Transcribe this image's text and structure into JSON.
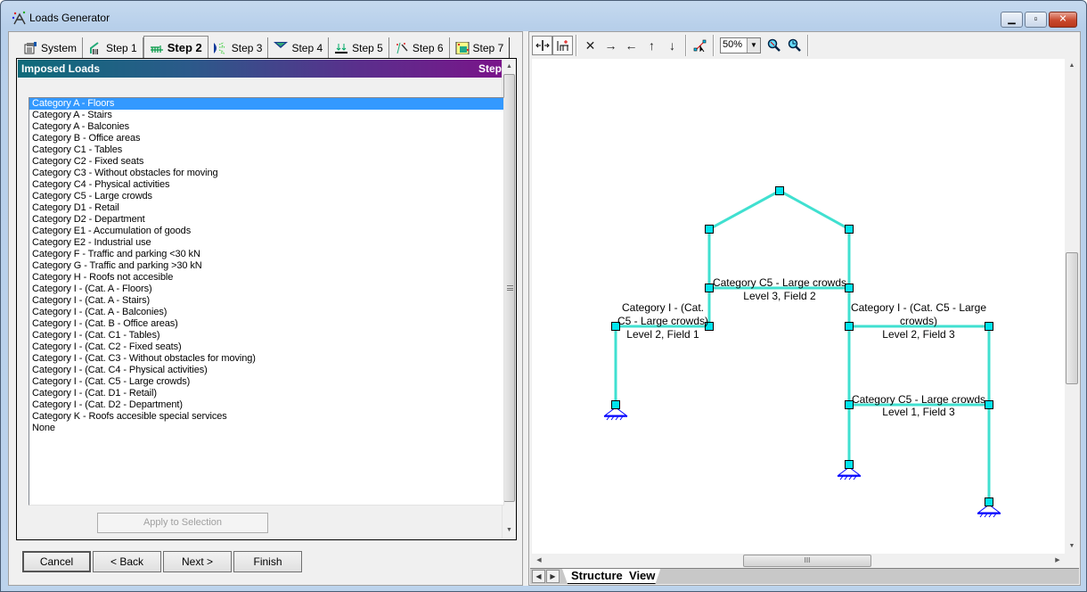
{
  "window": {
    "title": "Loads Generator",
    "controls": {
      "minimize": "minimize",
      "maximize": "maximize",
      "close": "close"
    }
  },
  "tabs": [
    {
      "label": "System",
      "icon": "system-icon",
      "active": false
    },
    {
      "label": "Step 1",
      "icon": "building-icon",
      "active": false
    },
    {
      "label": "Step 2",
      "icon": "load-icon",
      "active": true
    },
    {
      "label": "Step 3",
      "icon": "wind-icon",
      "active": false
    },
    {
      "label": "Step 4",
      "icon": "snow-icon",
      "active": false
    },
    {
      "label": "Step 5",
      "icon": "support-load-icon",
      "active": false
    },
    {
      "label": "Step 6",
      "icon": "wand-icon",
      "active": false
    },
    {
      "label": "Step 7",
      "icon": "table-icon",
      "active": false
    }
  ],
  "panel": {
    "title": "Imposed Loads",
    "step_label": "Step",
    "apply_button": "Apply to Selection",
    "selected_index": 0,
    "categories": [
      "Category A - Floors",
      "Category A - Stairs",
      "Category A - Balconies",
      "Category B - Office areas",
      "Category C1 - Tables",
      "Category C2 - Fixed seats",
      "Category C3 - Without obstacles for moving",
      "Category C4 - Physical activities",
      "Category C5 - Large crowds",
      "Category D1 - Retail",
      "Category D2 - Department",
      "Category E1 - Accumulation of goods",
      "Category E2 - Industrial use",
      "Category F - Traffic and parking <30 kN",
      "Category G - Traffic and parking >30 kN",
      "Category H - Roofs not accesible",
      "Category I - (Cat. A - Floors)",
      "Category I - (Cat. A - Stairs)",
      "Category I - (Cat. A - Balconies)",
      "Category I - (Cat. B - Office areas)",
      "Category I - (Cat. C1 - Tables)",
      "Category I - (Cat. C2 - Fixed seats)",
      "Category I - (Cat. C3 - Without obstacles for moving)",
      "Category I - (Cat. C4 - Physical activities)",
      "Category I - (Cat. C5 - Large crowds)",
      "Category I - (Cat. D1 - Retail)",
      "Category I - (Cat. D2 - Department)",
      "Category K - Roofs accesible special services",
      "None"
    ]
  },
  "wizard_buttons": {
    "cancel": "Cancel",
    "back": "< Back",
    "next": "Next >",
    "finish": "Finish"
  },
  "viewer": {
    "toolbar": {
      "zoom_value": "50%",
      "tools": [
        "select-member-icon",
        "add-member-icon",
        "delete-icon",
        "arrow-right-icon",
        "arrow-left-icon",
        "arrow-up-icon",
        "arrow-down-icon",
        "node-pick-icon",
        "zoom-in-icon",
        "zoom-fit-icon"
      ]
    },
    "sheet_tab": "Structure  View",
    "scroll_grip": "III",
    "structure": {
      "labels": [
        {
          "line1": "Category C5 - Large crowds",
          "line2": "Level 3, Field 2"
        },
        {
          "line1": "Category I - (Cat.",
          "line1b": "C5 - Large crowds)",
          "line2": "Level 2, Field 1"
        },
        {
          "line1": "Category I -  (Cat. C5 - Large",
          "line1b": "crowds)",
          "line2": "Level 2, Field 3"
        },
        {
          "line1": "Category C5 - Large crowds",
          "line2": "Level 1, Field 3"
        }
      ],
      "colors": {
        "member": "#40e0d0",
        "node": "#00e5f0",
        "support": "#0000ff"
      }
    }
  }
}
